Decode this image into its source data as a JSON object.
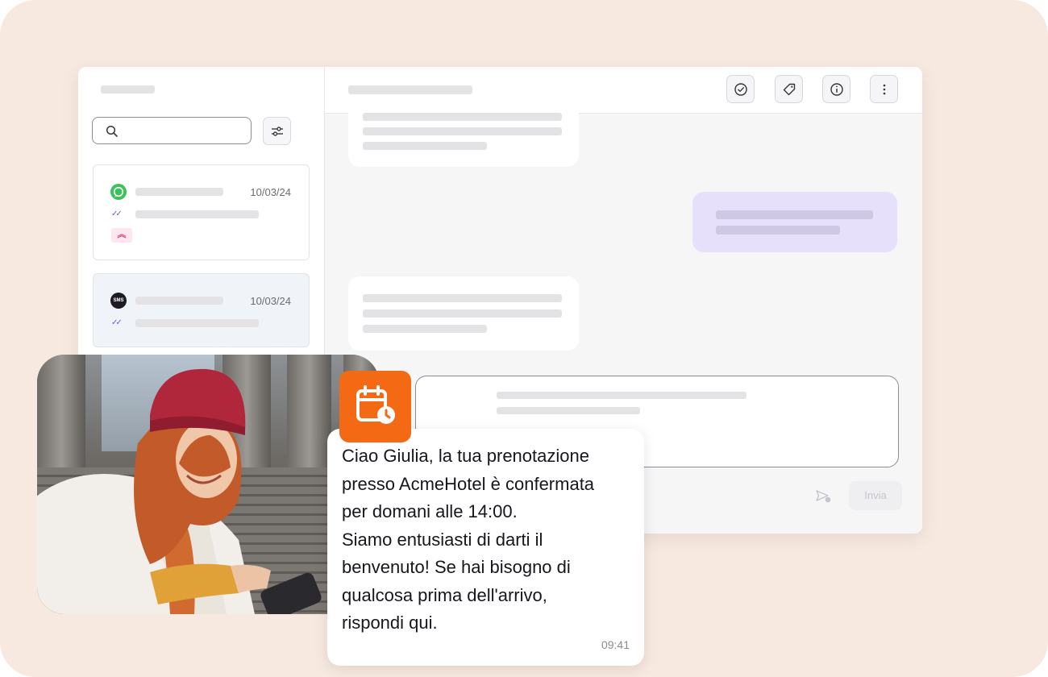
{
  "sidebar": {
    "conversations": [
      {
        "channel": "whatsapp-icon",
        "date": "10/03/24",
        "priority_icon": "chevron-up-icon"
      },
      {
        "channel": "sms-icon",
        "channel_label": "SMS",
        "date": "10/03/24"
      }
    ]
  },
  "topbar": {
    "actions": [
      "check-circle-icon",
      "tag-icon",
      "info-icon",
      "more-vertical-icon"
    ]
  },
  "composer": {
    "send_label": "Invia"
  },
  "notification": {
    "message": "Ciao Giulia, la tua prenotazione\npresso AcmeHotel è confermata\nper domani alle 14:00.\nSiamo entusiasti di darti il\nbenvenuto! Se hai bisogno di\nqualcosa prima dell'arrivo,\nrispondi qui.",
    "time": "09:41",
    "badge_icon": "calendar-clock-icon"
  },
  "colors": {
    "background": "#f7e9df",
    "accent_orange": "#f46a14",
    "outgoing_bubble": "#e7e0fb",
    "whatsapp_green": "#3cc25a"
  }
}
